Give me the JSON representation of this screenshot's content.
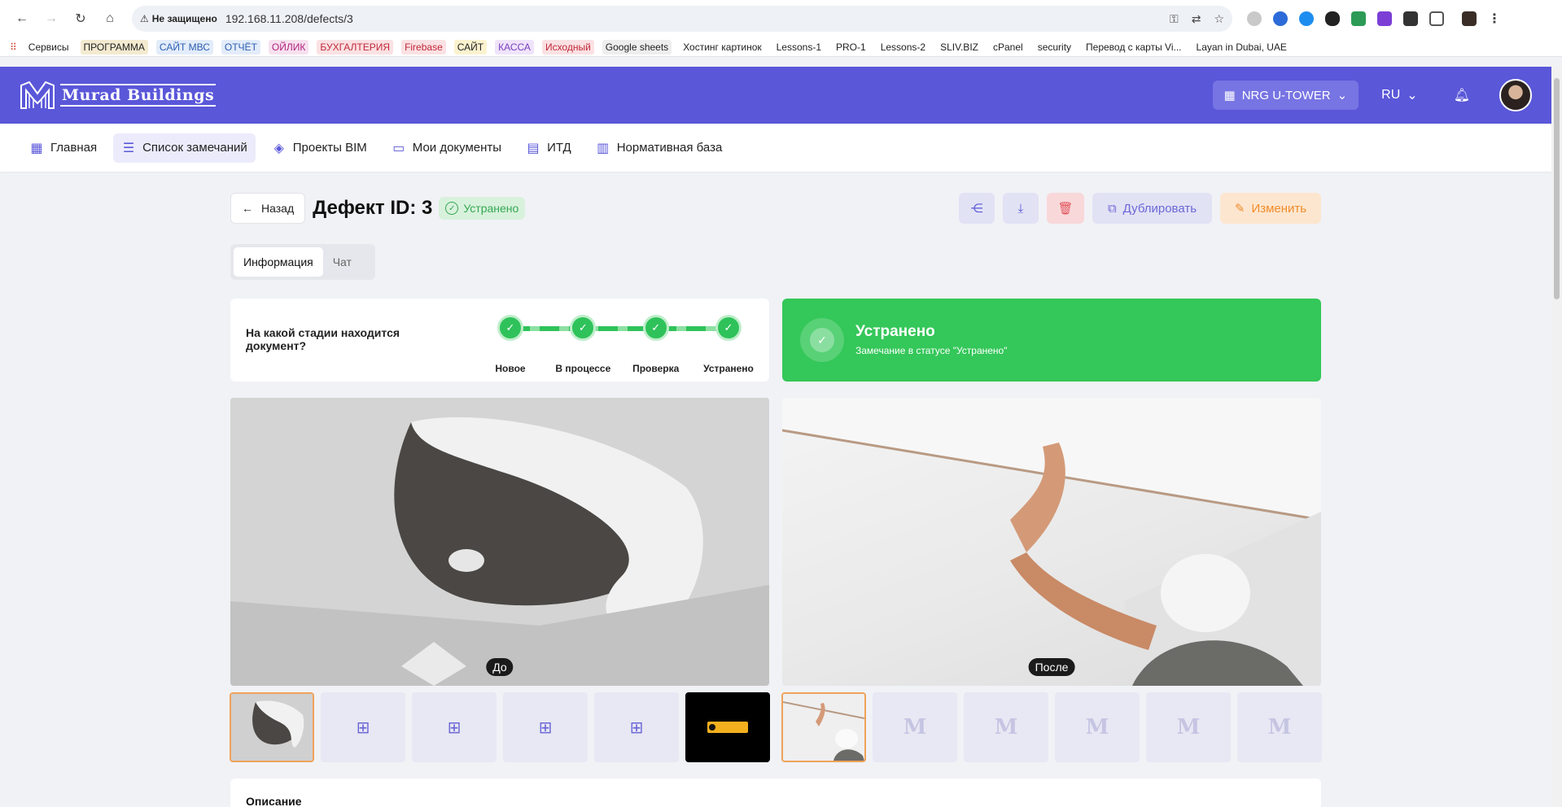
{
  "browser": {
    "insecure_label": "Не защищено",
    "url": "192.168.11.208/defects/3",
    "bookmarks": [
      {
        "label": "Сервисы",
        "color": "#222222",
        "bg": "transparent"
      },
      {
        "label": "ПРОГРАММА",
        "color": "#222222",
        "bg": "#f3ead0"
      },
      {
        "label": "САЙТ МВС",
        "color": "#2c5fb0",
        "bg": "#e3ecfa"
      },
      {
        "label": "ОТЧЁТ",
        "color": "#2c5fb0",
        "bg": "#e3ecfa"
      },
      {
        "label": "ОЙЛИК",
        "color": "#b0247f",
        "bg": "#f7e1ef"
      },
      {
        "label": "БУХГАЛТЕРИЯ",
        "color": "#c02838",
        "bg": "#fbe1e3"
      },
      {
        "label": "Firebase",
        "color": "#c02838",
        "bg": "#fbe1e3"
      },
      {
        "label": "САЙТ",
        "color": "#222222",
        "bg": "#fbf2cf"
      },
      {
        "label": "КАССА",
        "color": "#7a3fc0",
        "bg": "#efe4fb"
      },
      {
        "label": "Исходный",
        "color": "#c02838",
        "bg": "#fbe1e3"
      },
      {
        "label": "Google sheets",
        "color": "#222222",
        "bg": "#eeeeee"
      },
      {
        "label": "Хостинг картинок",
        "color": "#222222",
        "bg": "transparent"
      },
      {
        "label": "Lessons-1",
        "color": "#222222",
        "bg": "transparent"
      },
      {
        "label": "PRO-1",
        "color": "#222222",
        "bg": "transparent"
      },
      {
        "label": "Lessons-2",
        "color": "#222222",
        "bg": "transparent"
      },
      {
        "label": "SLIV.BIZ",
        "color": "#222222",
        "bg": "transparent"
      },
      {
        "label": "cPanel",
        "color": "#222222",
        "bg": "transparent"
      },
      {
        "label": "security",
        "color": "#222222",
        "bg": "transparent"
      },
      {
        "label": "Перевод с карты Vi...",
        "color": "#222222",
        "bg": "transparent"
      },
      {
        "label": "Layan in Dubai, UAE",
        "color": "#222222",
        "bg": "transparent"
      }
    ]
  },
  "header": {
    "brand": "Murad Buildings",
    "project": "NRG U-TOWER",
    "lang": "RU"
  },
  "nav": {
    "items": [
      {
        "label": "Главная",
        "icon": "grid-icon",
        "glyph": "▦",
        "active": false
      },
      {
        "label": "Список замечаний",
        "icon": "document-list-icon",
        "glyph": "☰",
        "active": true
      },
      {
        "label": "Проекты BIM",
        "icon": "layers-icon",
        "glyph": "◈",
        "active": false
      },
      {
        "label": "Мои документы",
        "icon": "folder-icon",
        "glyph": "▭",
        "active": false
      },
      {
        "label": "ИТД",
        "icon": "file-icon",
        "glyph": "▤",
        "active": false
      },
      {
        "label": "Нормативная база",
        "icon": "book-icon",
        "glyph": "▥",
        "active": false
      }
    ]
  },
  "defect": {
    "back_label": "Назад",
    "title": "Дефект ID: 3",
    "status": "Устранено",
    "duplicate_label": "Дублировать",
    "edit_label": "Изменить"
  },
  "tabs": {
    "info": "Информация",
    "chat": "Чат"
  },
  "stage": {
    "question": "На какой стадии находится документ?",
    "steps": [
      "Новое",
      "В процессе",
      "Проверка",
      "Устранено"
    ]
  },
  "status_card": {
    "title": "Устранено",
    "subtitle": "Замечание в статусе \"Устранено\""
  },
  "photos": {
    "before_label": "До",
    "after_label": "После"
  },
  "description": {
    "title": "Описание"
  },
  "colors": {
    "accent": "#5a57d9",
    "success": "#34c759",
    "danger": "#e0545b",
    "warning": "#ef8d2c"
  }
}
